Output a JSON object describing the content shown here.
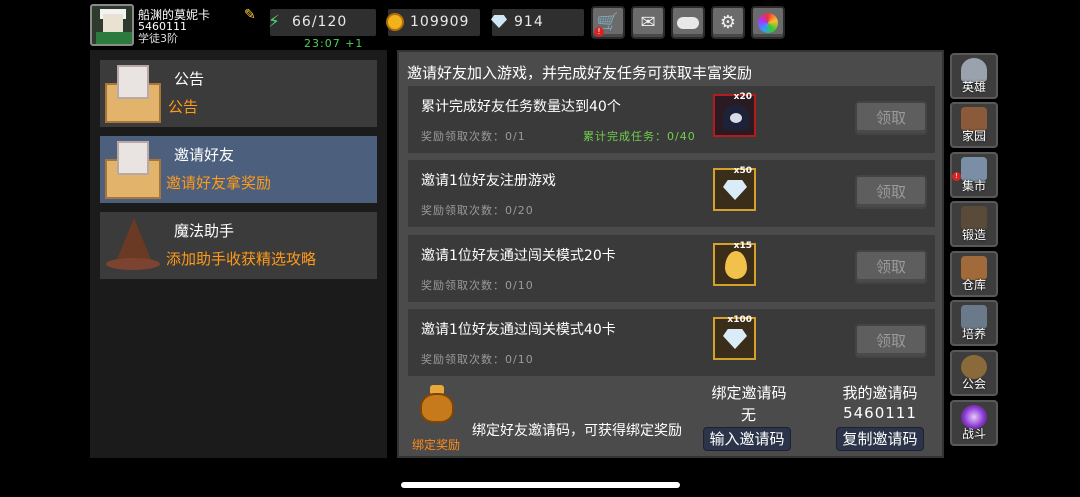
{
  "player": {
    "name": "船渊的莫妮卡",
    "id": "5460111",
    "subtitle": "学徒3阶"
  },
  "resources": {
    "energy": "66/120",
    "coins": "109909",
    "gems": "914",
    "timer": "23:07 +1"
  },
  "top_buttons": [
    {
      "name": "shop",
      "icon": "cart-icon"
    },
    {
      "name": "mail",
      "icon": "envelope-icon"
    },
    {
      "name": "gamepad",
      "icon": "gamepad-icon"
    },
    {
      "name": "settings",
      "icon": "gear-icon"
    },
    {
      "name": "gallery",
      "icon": "color-wheel-icon"
    }
  ],
  "menu": [
    {
      "title": "公告",
      "subtitle": "公告",
      "icon": "mail-letter-icon",
      "active": false
    },
    {
      "title": "邀请好友",
      "subtitle": "邀请好友拿奖励",
      "icon": "mail-letter-icon",
      "active": true
    },
    {
      "title": "魔法助手",
      "subtitle": "添加助手收获精选攻略",
      "icon": "wizard-hat-icon",
      "active": false
    }
  ],
  "main": {
    "header": "邀请好友加入游戏，并完成好友任务可获取丰富奖励",
    "tasks": [
      {
        "title": "累计完成好友任务数量达到40个",
        "count": "奖励领取次数：0/1",
        "progress": "累计完成任务：0/40",
        "reward_qty": "x20",
        "reward_icon": "ghost-icon",
        "claim": "领取"
      },
      {
        "title": "邀请1位好友注册游戏",
        "count": "奖励领取次数：0/20",
        "progress": "",
        "reward_qty": "x50",
        "reward_icon": "gem-icon",
        "claim": "领取"
      },
      {
        "title": "邀请1位好友通过闯关模式20卡",
        "count": "奖励领取次数：0/10",
        "progress": "",
        "reward_qty": "x15",
        "reward_icon": "egg-icon",
        "claim": "领取"
      },
      {
        "title": "邀请1位好友通过闯关模式40卡",
        "count": "奖励领取次数：0/10",
        "progress": "",
        "reward_qty": "x100",
        "reward_icon": "gem-icon",
        "claim": "领取"
      }
    ],
    "bind": {
      "bag_label": "绑定奖励",
      "description": "绑定好友邀请码，可获得绑定奖励",
      "bind_code_label": "绑定邀请码",
      "bind_code_value": "无",
      "my_code_label": "我的邀请码",
      "my_code_value": "5460111",
      "enter_button": "输入邀请码",
      "copy_button": "复制邀请码"
    }
  },
  "right_nav": [
    {
      "label": "英雄",
      "icon": "knight-helmet-icon",
      "color": "#9aa3ad"
    },
    {
      "label": "家园",
      "icon": "castle-icon",
      "color": "#8a5a3a"
    },
    {
      "label": "集市",
      "icon": "market-stall-icon",
      "color": "#7a8fa6"
    },
    {
      "label": "锻造",
      "icon": "anvil-hammer-icon",
      "color": "#5a4a3a"
    },
    {
      "label": "仓库",
      "icon": "warehouse-chest-icon",
      "color": "#a06a3a"
    },
    {
      "label": "培养",
      "icon": "goblet-icon",
      "color": "#6a7a8a"
    },
    {
      "label": "公会",
      "icon": "guild-emblem-icon",
      "color": "#8a6a3a"
    },
    {
      "label": "战斗",
      "icon": "portal-icon",
      "color": "#8a3ad0"
    }
  ]
}
